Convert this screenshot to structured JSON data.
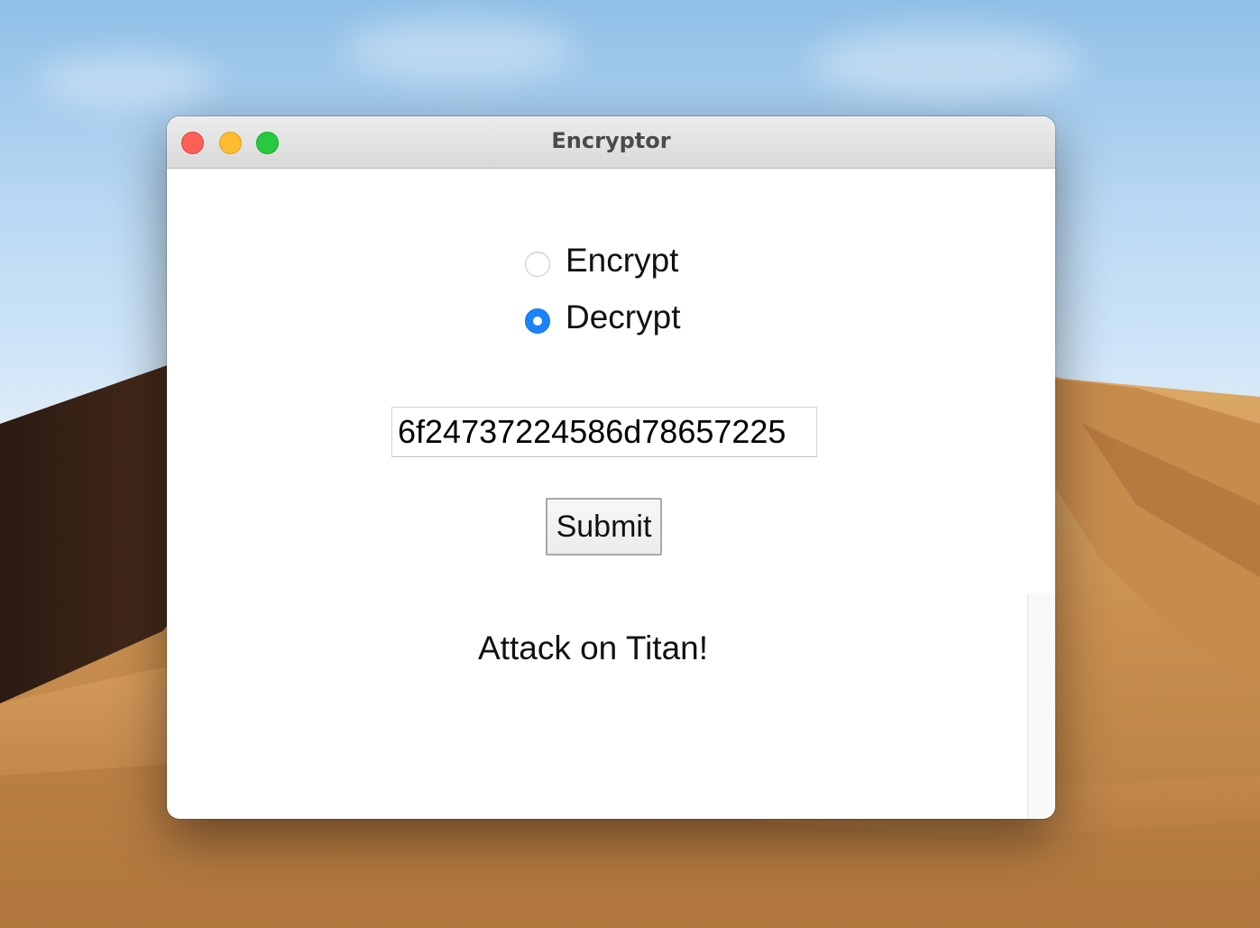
{
  "window": {
    "title": "Encryptor"
  },
  "traffic_lights": {
    "close_color": "#fe5f57",
    "minimize_color": "#febc2e",
    "zoom_color": "#28c840"
  },
  "mode": {
    "options": [
      {
        "label": "Encrypt",
        "selected": false
      },
      {
        "label": "Decrypt",
        "selected": true
      }
    ],
    "accent_color": "#1a82fb"
  },
  "input": {
    "value": "6f24737224586d78657225"
  },
  "submit": {
    "label": "Submit"
  },
  "output": {
    "text": "Attack on Titan!"
  }
}
